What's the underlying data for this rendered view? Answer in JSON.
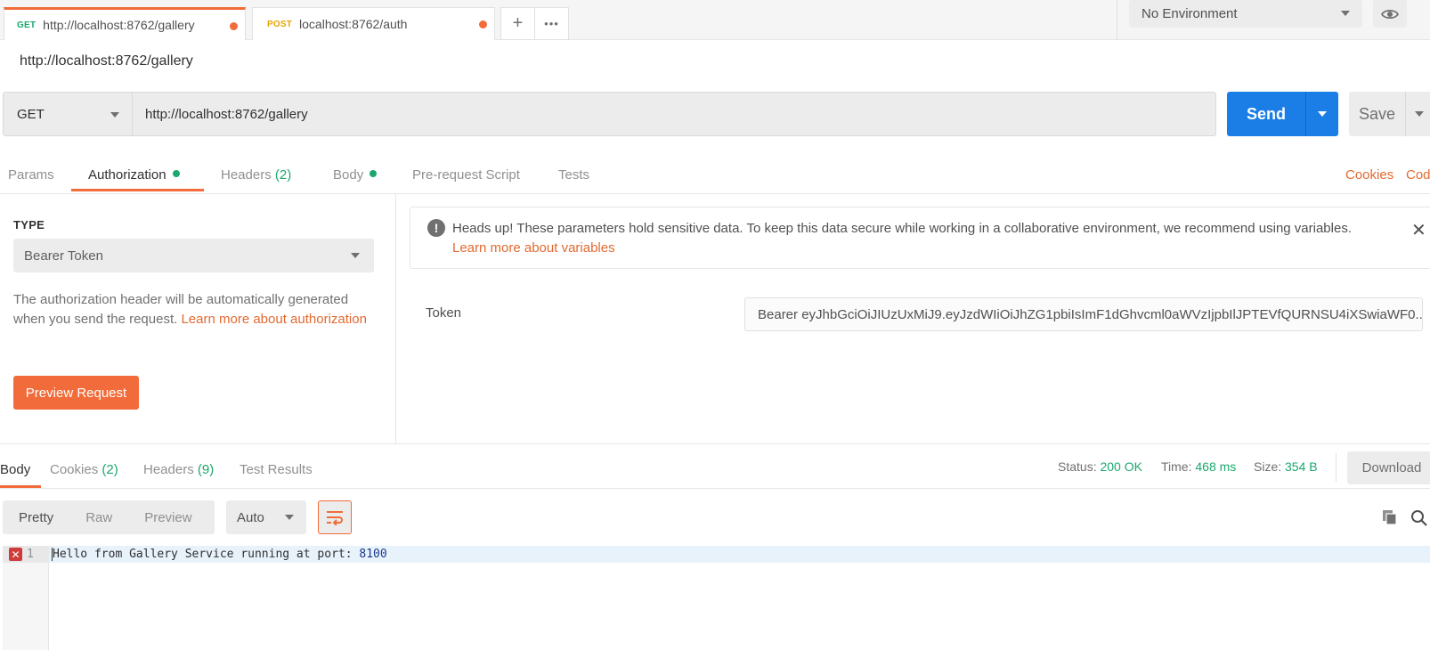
{
  "tabs": [
    {
      "method": "GET",
      "method_color": "#1ba86e",
      "label": "http://localhost:8762/gallery"
    },
    {
      "method": "POST",
      "method_color": "#e8a400",
      "label": "localhost:8762/auth"
    }
  ],
  "tab_buttons": {
    "add_icon": "+",
    "more_icon": "•••"
  },
  "environment": {
    "selected": "No Environment"
  },
  "request": {
    "title": "http://localhost:8762/gallery",
    "method": "GET",
    "url": "http://localhost:8762/gallery",
    "send_label": "Send",
    "save_label": "Save"
  },
  "request_tabs": {
    "params": "Params",
    "authorization": "Authorization",
    "headers": "Headers",
    "headers_count": "(2)",
    "body": "Body",
    "prerequest": "Pre-request Script",
    "tests": "Tests",
    "cookies": "Cookies",
    "code": "Code"
  },
  "auth": {
    "type_label": "TYPE",
    "type_value": "Bearer Token",
    "description": "The authorization header will be automatically generated when you send the request. ",
    "description_link": "Learn more about authorization",
    "preview_button": "Preview Request",
    "alert_text": "Heads up! These parameters hold sensitive data. To keep this data secure while working in a collaborative environment, we recommend using variables.",
    "alert_link": "Learn more about variables",
    "token_label": "Token",
    "token_value": "Bearer eyJhbGciOiJIUzUxMiJ9.eyJzdWIiOiJhZG1pbiIsImF1dGhvcml0aWVzIjpbIlJPTEVfQURNSU4iXSwiaWF0..."
  },
  "response": {
    "tabs": {
      "body": "Body",
      "cookies": "Cookies",
      "cookies_count": "(2)",
      "headers": "Headers",
      "headers_count": "(9)",
      "test_results": "Test Results"
    },
    "status_label": "Status:",
    "status_value": "200 OK",
    "time_label": "Time:",
    "time_value": "468 ms",
    "size_label": "Size:",
    "size_value": "354 B",
    "download_label": "Download",
    "formats": [
      "Pretty",
      "Raw",
      "Preview"
    ],
    "auto_label": "Auto",
    "line_number": "1",
    "body_text": "Hello from Gallery Service running at port: ",
    "body_number": "8100"
  }
}
